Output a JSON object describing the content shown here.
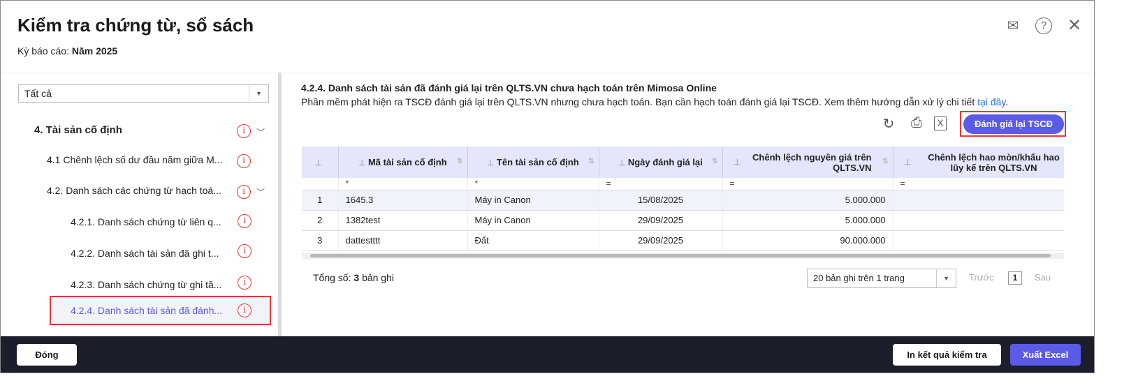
{
  "header": {
    "title": "Kiểm tra chứng từ, sổ sách",
    "period_label": "Kỳ báo cáo:",
    "period_value": "Năm 2025",
    "icons": [
      "mail-forward-icon",
      "help-icon",
      "close-icon"
    ]
  },
  "sidebar": {
    "filter_value": "Tất cả",
    "items": [
      {
        "label": "4. Tài sản cố định"
      },
      {
        "label": "4.1 Chênh lệch số dư đầu năm giữa M..."
      },
      {
        "label": "4.2. Danh sách các chứng từ hạch toá..."
      },
      {
        "label": "4.2.1. Danh sách chứng từ liên q..."
      },
      {
        "label": "4.2.2. Danh sách tài sản đã ghi t..."
      },
      {
        "label": "4.2.3. Danh sách chứng từ ghi tă..."
      },
      {
        "label": "4.2.4. Danh sách tài sản đã đánh..."
      }
    ],
    "selected_color": "#5b5be6"
  },
  "main": {
    "title": "4.2.4. Danh sách tài sản đã đánh giá lại trên QLTS.VN chưa hạch toán trên Mimosa Online",
    "description": "Phần mềm phát hiện ra TSCĐ đánh giá lại trên QLTS.VN nhưng chưa hạch toán. Bạn cần hạch toán đánh giá lại TSCĐ. Xem thêm hướng dẫn xử lý chi tiết ",
    "link": "tại đây",
    "primary_button": "Đánh giá lại TSCĐ",
    "columns": [
      "Mã tài sản cố định",
      "Tên tài sản cố định",
      "Ngày đánh giá lại",
      "Chênh lệch nguyên giá trên QLTS.VN",
      "Chênh lệch hao mòn/khấu hao lũy kế trên QLTS.VN"
    ],
    "filters": [
      "*",
      "*",
      "=",
      "=",
      "="
    ],
    "rows": [
      {
        "no": "1",
        "code": "1645.3",
        "name": "Máy in Canon",
        "date": "15/08/2025",
        "diff": "5.000.000",
        "dep": ""
      },
      {
        "no": "2",
        "code": "1382test",
        "name": "Máy in Canon",
        "date": "29/09/2025",
        "diff": "5.000.000",
        "dep": ""
      },
      {
        "no": "3",
        "code": "dattestttt",
        "name": "Đất",
        "date": "29/09/2025",
        "diff": "90.000.000",
        "dep": ""
      }
    ],
    "total_label": "Tổng số:",
    "total_count": "3",
    "total_suffix": "bản ghi",
    "page_size": "20 bản ghi trên 1 trang",
    "prev": "Trước",
    "page": "1",
    "next": "Sau"
  },
  "footer": {
    "close": "Đóng",
    "print": "In kết quả kiểm tra",
    "export": "Xuất Excel"
  },
  "colors": {
    "accent": "#5b5be6",
    "footer_bg": "#1c1f2b",
    "highlight": "#e53935"
  }
}
